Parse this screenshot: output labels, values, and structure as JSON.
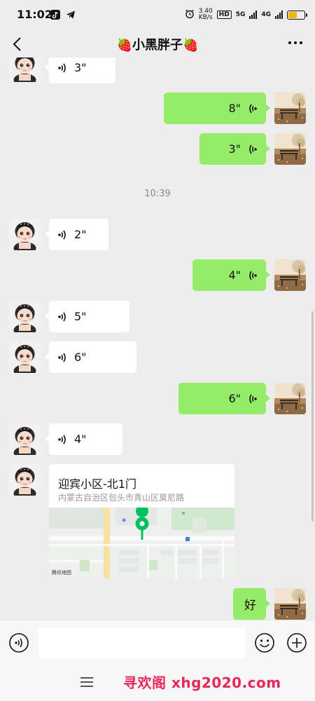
{
  "status_bar": {
    "time": "11:02",
    "net_speed_value": "3.40",
    "net_speed_unit": "KB/s",
    "hd_badge": "HD",
    "network_5g": "5G",
    "network_4g": "4G",
    "battery_color": "#f5b400"
  },
  "header": {
    "title": "🍓小黑胖子🍓"
  },
  "chat": {
    "time_divider": "10:39",
    "messages": [
      {
        "side": "left",
        "type": "voice",
        "duration": "3\""
      },
      {
        "side": "right",
        "type": "voice",
        "duration": "8\""
      },
      {
        "side": "right",
        "type": "voice",
        "duration": "3\""
      },
      {
        "side": "left",
        "type": "voice",
        "duration": "2\""
      },
      {
        "side": "right",
        "type": "voice",
        "duration": "4\""
      },
      {
        "side": "left",
        "type": "voice",
        "duration": "5\""
      },
      {
        "side": "left",
        "type": "voice",
        "duration": "6\""
      },
      {
        "side": "right",
        "type": "voice",
        "duration": "6\""
      },
      {
        "side": "left",
        "type": "voice",
        "duration": "4\""
      },
      {
        "side": "right",
        "type": "text",
        "text": "好"
      }
    ],
    "location": {
      "title": "迎宾小区-北1门",
      "address": "内蒙古自治区包头市青山区莫尼路",
      "map_credit": "腾讯地图"
    }
  },
  "input_bar": {
    "placeholder": ""
  },
  "watermark": "寻欢阁 xhg2020.com",
  "colors": {
    "outgoing_bubble": "#95ec69",
    "incoming_bubble": "#ffffff",
    "background": "#ededed",
    "map_pin": "#07c160",
    "watermark": "#e8285a"
  }
}
